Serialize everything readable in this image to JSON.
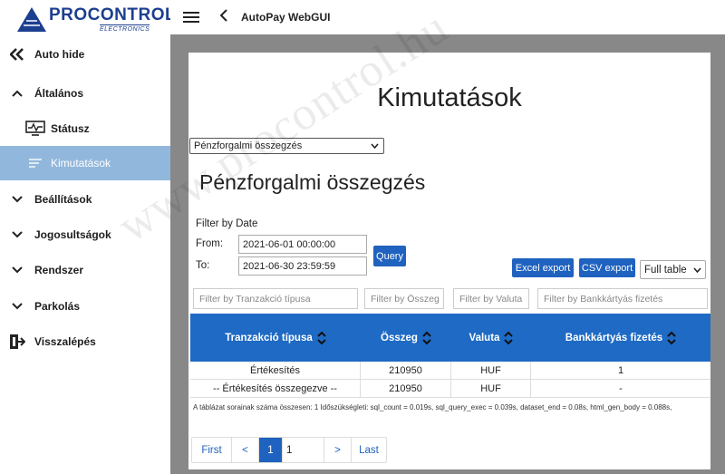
{
  "logo": {
    "name": "PROCONTROL",
    "sub": "ELECTRONICS"
  },
  "topbar": {
    "title": "AutoPay WebGUI"
  },
  "sidebar": {
    "items": [
      {
        "label": "Auto hide"
      },
      {
        "label": "Általános"
      },
      {
        "label": "Státusz"
      },
      {
        "label": "Kimutatások"
      },
      {
        "label": "Beállítások"
      },
      {
        "label": "Jogosultságok"
      },
      {
        "label": "Rendszer"
      },
      {
        "label": "Parkolás"
      },
      {
        "label": "Visszalépés"
      }
    ]
  },
  "main": {
    "title": "Kimutatások",
    "report_select": "Pénzforgalmi összegzés",
    "section_title": "Pénzforgalmi összegzés",
    "filter_label": "Filter by Date",
    "from_label": "From:",
    "to_label": "To:",
    "from_value": "2021-06-01 00:00:00",
    "to_value": "2021-06-30 23:59:59",
    "query_button": "Query",
    "excel_button": "Excel export",
    "csv_button": "CSV export",
    "table_mode": "Full table",
    "filters": {
      "type": "Filter by Tranzakció típusa",
      "amount": "Filter by Összeg",
      "currency": "Filter by Valuta",
      "card": "Filter by Bankkártyás fizetés"
    },
    "columns": [
      "Tranzakció típusa",
      "Összeg",
      "Valuta",
      "Bankkártyás fizetés"
    ],
    "rows": [
      [
        "Értékesítés",
        "210950",
        "HUF",
        "1"
      ],
      [
        "-- Értékesítés összegezve --",
        "210950",
        "HUF",
        "-"
      ]
    ],
    "info": "A táblázat sorainak száma összesen: 1   Időszükségleti: sql_count = 0.019s, sql_query_exec = 0.039s, dataset_end = 0.08s, html_gen_body = 0.088s,",
    "pager": {
      "first": "First",
      "prev": "<",
      "current": "1",
      "page_input": "1",
      "next": ">",
      "last": "Last"
    }
  },
  "watermark": "www.procontrol.hu",
  "colors": {
    "accent": "#1f62bf",
    "header": "#1e6ac4",
    "sidebar_active": "#92b7dc",
    "brand": "#1c3f8f"
  }
}
